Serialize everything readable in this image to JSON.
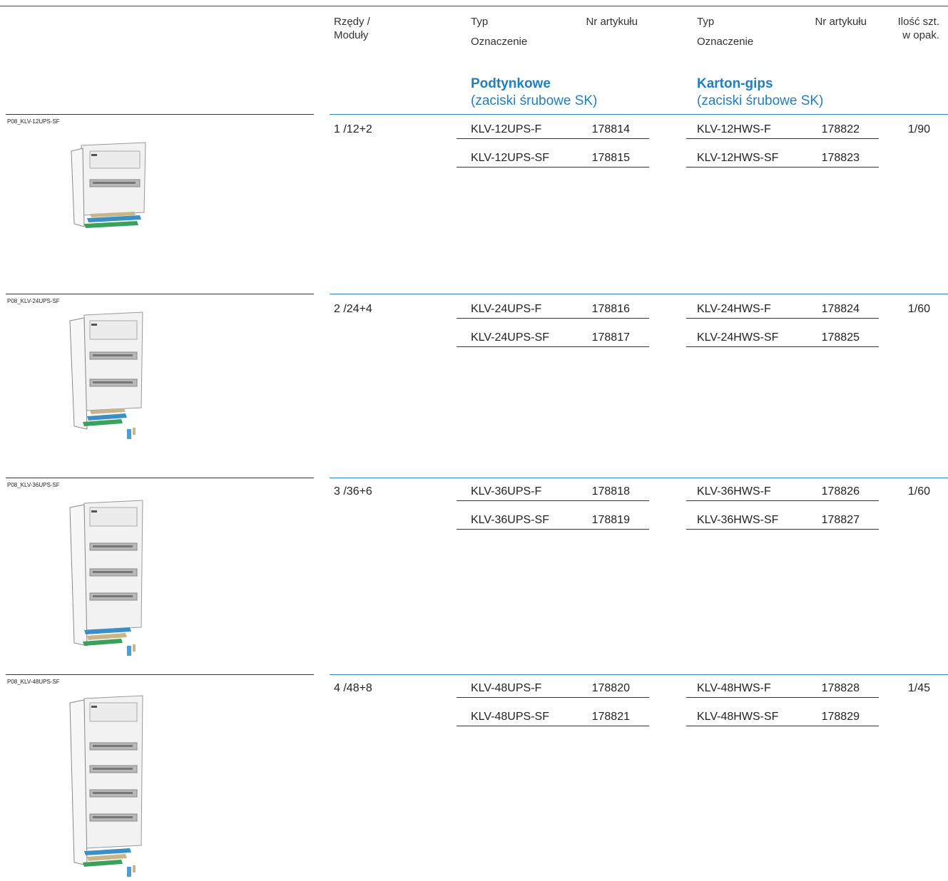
{
  "header": {
    "rows_modules": "Rzędy /\nModuły",
    "col_a_type": "Typ",
    "col_a_desc": "Oznaczenie",
    "col_a_artno": "Nr artykułu",
    "col_b_type": "Typ",
    "col_b_desc": "Oznaczenie",
    "col_b_artno": "Nr artykułu",
    "pack_qty": "Ilość szt.\nw opak."
  },
  "sections": {
    "a_title": "Podtynkowe",
    "a_sub": "(zaciski śrubowe SK)",
    "b_title": "Karton-gips",
    "b_sub": "(zaciski śrubowe SK)"
  },
  "rows": [
    {
      "image_label": "P08_KLV-12UPS-SF",
      "rows_modules": "1 /12+2",
      "a": [
        {
          "type": "KLV-12UPS-F",
          "artno": "178814"
        },
        {
          "type": "KLV-12UPS-SF",
          "artno": "178815"
        }
      ],
      "b": [
        {
          "type": "KLV-12HWS-F",
          "artno": "178822"
        },
        {
          "type": "KLV-12HWS-SF",
          "artno": "178823"
        }
      ],
      "pack": "1/90"
    },
    {
      "image_label": "P08_KLV-24UPS-SF",
      "rows_modules": "2 /24+4",
      "a": [
        {
          "type": "KLV-24UPS-F",
          "artno": "178816"
        },
        {
          "type": "KLV-24UPS-SF",
          "artno": "178817"
        }
      ],
      "b": [
        {
          "type": "KLV-24HWS-F",
          "artno": "178824"
        },
        {
          "type": "KLV-24HWS-SF",
          "artno": "178825"
        }
      ],
      "pack": "1/60"
    },
    {
      "image_label": "P08_KLV-36UPS-SF",
      "rows_modules": "3 /36+6",
      "a": [
        {
          "type": "KLV-36UPS-F",
          "artno": "178818"
        },
        {
          "type": "KLV-36UPS-SF",
          "artno": "178819"
        }
      ],
      "b": [
        {
          "type": "KLV-36HWS-F",
          "artno": "178826"
        },
        {
          "type": "KLV-36HWS-SF",
          "artno": "178827"
        }
      ],
      "pack": "1/60"
    },
    {
      "image_label": "P08_KLV-48UPS-SF",
      "rows_modules": "4 /48+8",
      "a": [
        {
          "type": "KLV-48UPS-F",
          "artno": "178820"
        },
        {
          "type": "KLV-48UPS-SF",
          "artno": "178821"
        }
      ],
      "b": [
        {
          "type": "KLV-48HWS-F",
          "artno": "178828"
        },
        {
          "type": "KLV-48HWS-SF",
          "artno": "178829"
        }
      ],
      "pack": "1/45"
    }
  ],
  "colors": {
    "accent": "#1f7fc0",
    "rule": "#2e86c1"
  }
}
